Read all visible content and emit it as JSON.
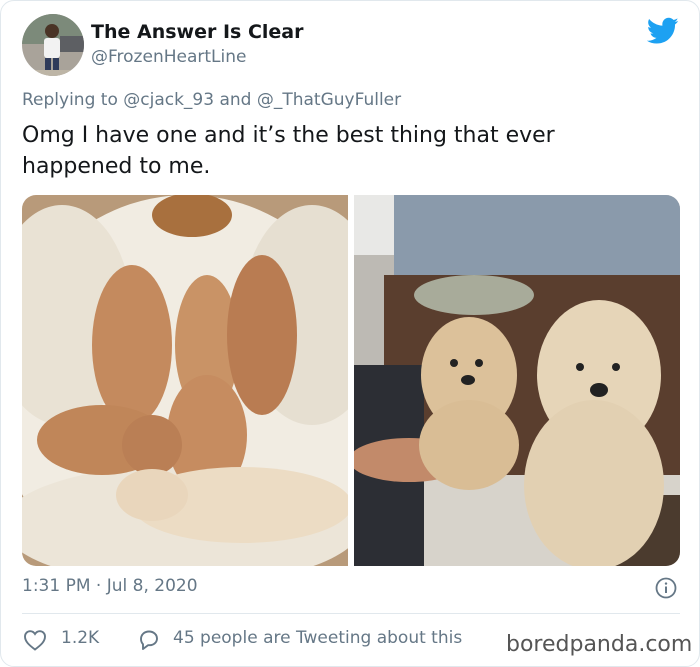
{
  "tweet": {
    "display_name": "The Answer Is Clear",
    "handle": "@FrozenHeartLine",
    "replying_prefix": "Replying to",
    "mention_1": "@cjack_93",
    "replying_and": "and",
    "mention_2": "@_ThatGuyFuller",
    "text": "Omg I have one and it’s the best thing that ever happened to me.",
    "timestamp": "1:31 PM · Jul 8, 2020",
    "like_count": "1.2K",
    "conversation_text": "45 people are Tweeting about this"
  },
  "watermark": "boredpanda.com",
  "icons": {
    "brand": "twitter-bird-icon",
    "info": "info-icon",
    "like": "heart-icon",
    "reply": "speech-bubble-icon"
  },
  "colors": {
    "twitter_blue": "#1da1f2",
    "secondary_text": "#657786",
    "primary_text": "#14171a",
    "border": "#e1e8ed"
  }
}
